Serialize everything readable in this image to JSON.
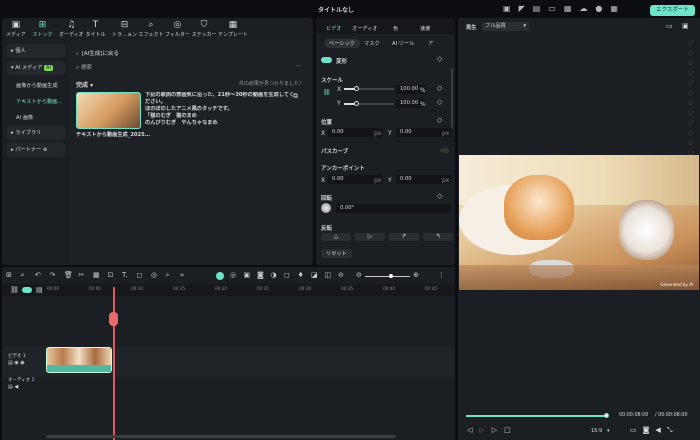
{
  "app": {
    "title": "タイトルなし",
    "export_label": "エクスポート"
  },
  "accent": "#6fe3c8",
  "toolbar": [
    {
      "label": "メディア",
      "icon": "media-icon"
    },
    {
      "label": "ストック",
      "icon": "stock-icon",
      "active": true
    },
    {
      "label": "オーディオ",
      "icon": "music-icon"
    },
    {
      "label": "タイトル",
      "icon": "title-icon"
    },
    {
      "label": "トラ…ョン",
      "icon": "transition-icon"
    },
    {
      "label": "エフェクト",
      "icon": "effect-icon"
    },
    {
      "label": "フィルター",
      "icon": "filter-icon"
    },
    {
      "label": "ステッカー",
      "icon": "sticker-icon"
    },
    {
      "label": "テンプレート",
      "icon": "template-icon"
    }
  ],
  "sidebar": {
    "personal": "個人",
    "ai_media": "AI メディア",
    "ai_badge": "AI",
    "sub": [
      "画像から動画生成",
      "テキストから動画…",
      "AI 画像"
    ],
    "library": "ライブラリ",
    "partner": "パートナー"
  },
  "content": {
    "back": "[AI生成]に戻る",
    "search_placeholder": "検索",
    "filter": "完成",
    "result_count": "件の結果が見つかりました！",
    "item": {
      "description": "下記の歌詞の雰囲気に沿った、21秒〜30秒の動画を生成してください。\nほのぼのしたアニメ風のタッチです。\n「猫のむぎ　猫のまめ\nのんびりむぎ　やんちゃなまめ",
      "name": "テキストから動画生成_2025…"
    }
  },
  "props": {
    "tabs": [
      "ビデオ",
      "オーディオ",
      "色",
      "速度"
    ],
    "subtabs": [
      "ベーシック",
      "マスク",
      "AI ツール",
      "ア"
    ],
    "transform": "変形",
    "scale": "スケール",
    "scale_x": "100.00",
    "scale_y": "100.00",
    "percent": "%",
    "position": "位置",
    "pos_x": "0.00",
    "pos_y": "0.00",
    "px": "px",
    "path_curve": "パスカーブ",
    "anchor": "アンカーポイント",
    "anc_x": "0.00",
    "anc_y": "0.00",
    "rotation": "回転",
    "rot": "0.00°",
    "flip": "反転",
    "reset": "リセット",
    "x": "X",
    "y": "Y"
  },
  "preview": {
    "label": "再生",
    "quality": "フル品質",
    "current": "00:00:08:00",
    "total": "/ 00:00:08:00",
    "ratio": "16:9",
    "progress": 1.0,
    "watermark": "Generated by AI"
  },
  "timeline": {
    "ticks": [
      "00:00",
      "00:05",
      "00:10",
      "00:15",
      "00:20",
      "00:25",
      "00:30",
      "00:35",
      "00:40",
      "00:45"
    ],
    "video_track": "ビデオ 1",
    "audio_track": "オーディオ 1",
    "playhead_time": "00:08"
  }
}
